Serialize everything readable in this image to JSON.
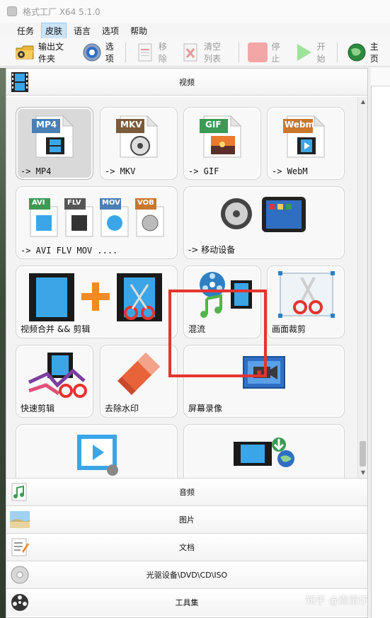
{
  "window": {
    "title": "格式工厂 X64 5.1.0"
  },
  "menu": [
    "任务",
    "皮肤",
    "语言",
    "选项",
    "帮助"
  ],
  "toolbar": {
    "output_folder": "输出文件夹",
    "options": "选项",
    "remove": "移除",
    "clear_list": "清空列表",
    "stop": "停止",
    "start": "开始",
    "home": "主页"
  },
  "sections": {
    "video": "视频",
    "audio": "音频",
    "image": "图片",
    "document": "文档",
    "disc": "光驱设备\\DVD\\CD\\ISO",
    "tools": "工具集"
  },
  "tiles": {
    "mp4": {
      "badge": "MP4",
      "label": "-> MP4"
    },
    "mkv": {
      "badge": "MKV",
      "label": "-> MKV"
    },
    "gif": {
      "badge": "GIF",
      "label": "-> GIF"
    },
    "webm": {
      "badge": "Webm",
      "label": "-> WebM"
    },
    "multi": {
      "badges": [
        "AVI",
        "FLV",
        "MOV",
        "VOB"
      ],
      "label": "-> AVI FLV MOV ...."
    },
    "mobile": {
      "label": "-> 移动设备"
    },
    "join": {
      "label": "视频合并 && 剪辑"
    },
    "mux": {
      "label": "混流"
    },
    "crop": {
      "label": "画面裁剪"
    },
    "quickcut": {
      "label": "快速剪辑"
    },
    "watermark": {
      "label": "去除水印"
    },
    "screenrec": {
      "label": "屏幕录像"
    }
  },
  "colors": {
    "highlight": "#e5342f",
    "mp4_badge": "#4a7fb5",
    "mkv_badge": "#7a5a3a",
    "gif_badge": "#3c9a55",
    "webm_badge": "#c9772c",
    "avi_badge": "#3c9a55",
    "flv_badge": "#555555",
    "mov_badge": "#4a7fb5",
    "vob_badge": "#c9772c"
  },
  "watermark": "知乎 @嵩鼠仔"
}
